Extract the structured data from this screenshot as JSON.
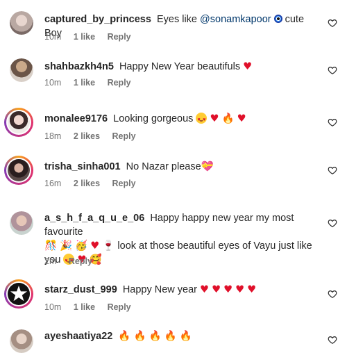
{
  "comments": [
    {
      "username": "captured_by_princess",
      "text_a": "Eyes like ",
      "mention": "@sonamkapoor",
      "text_b": "cute Boy",
      "time": "10m",
      "likes": "1 like",
      "reply": "Reply"
    },
    {
      "username": "shahbazkh4n5",
      "text": "Happy New Year beautifuls",
      "time": "10m",
      "likes": "1 like",
      "reply": "Reply"
    },
    {
      "username": "monalee9176",
      "text": "Looking gorgeous",
      "time": "18m",
      "likes": "2 likes",
      "reply": "Reply"
    },
    {
      "username": "trisha_sinha001",
      "text": "No Nazar please",
      "time": "16m",
      "likes": "2 likes",
      "reply": "Reply"
    },
    {
      "username": "a_s_h_f_a_q_u_e_06",
      "text_a": "Happy happy new year my most favourite",
      "text_b": "look at those beautiful eyes of Vayu just like",
      "text_c": "you",
      "time": "2m",
      "reply": "Reply"
    },
    {
      "username": "starz_dust_999",
      "text": "Happy New year",
      "time": "10m",
      "likes": "1 like",
      "reply": "Reply"
    },
    {
      "username": "ayeshaatiya22"
    }
  ],
  "icons": {
    "like": "heart-outline-icon"
  },
  "colors": {
    "text": "#262626",
    "meta": "#737373",
    "mention": "#00376b",
    "heart": "#e0102a"
  }
}
